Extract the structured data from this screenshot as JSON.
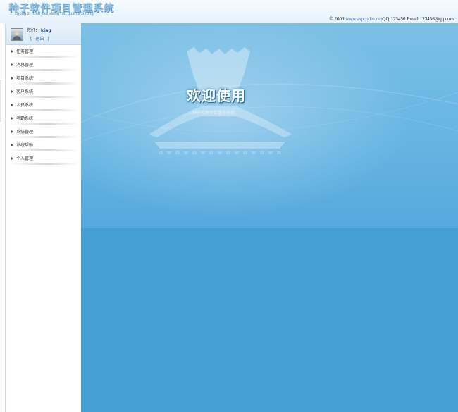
{
  "header": {
    "title": "种子软件项目管理系统",
    "subtitle_arrow": "→",
    "subtitle": "zhong zi ruan jian xiang mu guan li xi tong",
    "copyright_prefix": "© 2009",
    "copyright_site": "www.aspcodes.net",
    "copyright_contact": "QQ:123456 Email:123456@qq.com"
  },
  "user": {
    "greeting": "您好：",
    "name": "king",
    "bracket_open": "[",
    "logout_label": "退出",
    "bracket_close": "]"
  },
  "sidebar": {
    "items": [
      {
        "label": "任务管理"
      },
      {
        "label": "消息管理"
      },
      {
        "label": "项目系统"
      },
      {
        "label": "客户系统"
      },
      {
        "label": "人员系统"
      },
      {
        "label": "考勤系统"
      },
      {
        "label": "系统管理"
      },
      {
        "label": "系统帮助"
      },
      {
        "label": "个人管理"
      }
    ]
  },
  "main": {
    "welcome_title": "欢迎使用",
    "welcome_subtitle": "—种子软件项目管理系统"
  },
  "colors": {
    "main_bg": "#46a0d6",
    "banner_bg": "#6ab7e4",
    "link": "#2f6ba3"
  }
}
